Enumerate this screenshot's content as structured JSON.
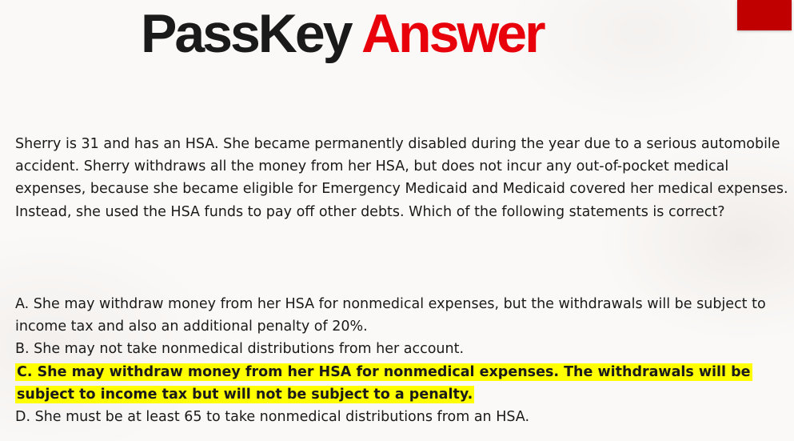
{
  "header": {
    "title_main": "PassKey",
    "title_accent": "Answer"
  },
  "colors": {
    "accent": "#e8000b",
    "corner_tab": "#c00000",
    "highlight": "#ffff00"
  },
  "question": "Sherry is 31 and has an HSA. She became permanently disabled during the year due to a serious automobile accident. Sherry withdraws all the money from her HSA, but does not incur any out-of-pocket medical expenses, because she became eligible for Emergency Medicaid and Medicaid covered her medical expenses. Instead, she used the HSA funds to pay off other debts. Which of the following statements is correct?",
  "options": [
    "A. She may withdraw money from her HSA for nonmedical expenses, but the withdrawals will be subject to income tax and also an additional penalty of 20%.",
    "B. She may not take nonmedical distributions from her account.",
    "C. She may withdraw money from her HSA for nonmedical expenses. The withdrawals will be subject to income tax but will not be subject to a penalty.",
    "D. She must be at least 65 to take nonmedical distributions from an HSA."
  ],
  "correct_option": "C"
}
